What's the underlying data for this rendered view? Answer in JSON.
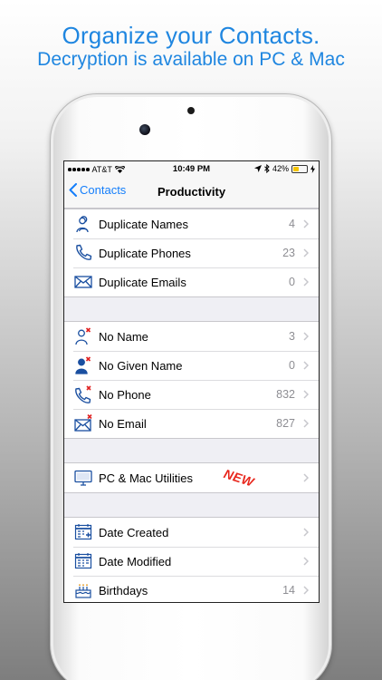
{
  "promo": {
    "headline": "Organize your Contacts.",
    "subheadline": "Decryption is available on PC & Mac"
  },
  "status_bar": {
    "carrier": "AT&T",
    "time": "10:49 PM",
    "battery": "42%",
    "battery_level": 0.42
  },
  "nav": {
    "back_label": "Contacts",
    "title": "Productivity"
  },
  "sections": [
    {
      "items": [
        {
          "label": "Duplicate Names",
          "count": "4",
          "icon": "duplicate-names-icon"
        },
        {
          "label": "Duplicate Phones",
          "count": "23",
          "icon": "duplicate-phones-icon"
        },
        {
          "label": "Duplicate Emails",
          "count": "0",
          "icon": "duplicate-emails-icon"
        }
      ]
    },
    {
      "items": [
        {
          "label": "No Name",
          "count": "3",
          "icon": "no-name-icon"
        },
        {
          "label": "No Given Name",
          "count": "0",
          "icon": "no-given-name-icon"
        },
        {
          "label": "No Phone",
          "count": "832",
          "icon": "no-phone-icon"
        },
        {
          "label": "No Email",
          "count": "827",
          "icon": "no-email-icon"
        }
      ]
    },
    {
      "items": [
        {
          "label": "PC & Mac Utilities",
          "count": "",
          "icon": "monitor-icon",
          "badge": "NEW"
        }
      ]
    },
    {
      "items": [
        {
          "label": "Date Created",
          "count": "",
          "icon": "calendar-add-icon"
        },
        {
          "label": "Date Modified",
          "count": "",
          "icon": "calendar-icon"
        },
        {
          "label": "Birthdays",
          "count": "14",
          "icon": "birthday-cake-icon"
        }
      ]
    }
  ],
  "colors": {
    "accent": "#147efb",
    "promo_text": "#1f86e0",
    "badge": "#e8261c",
    "icon": "#1a4fa0",
    "alert": "#e02020"
  }
}
